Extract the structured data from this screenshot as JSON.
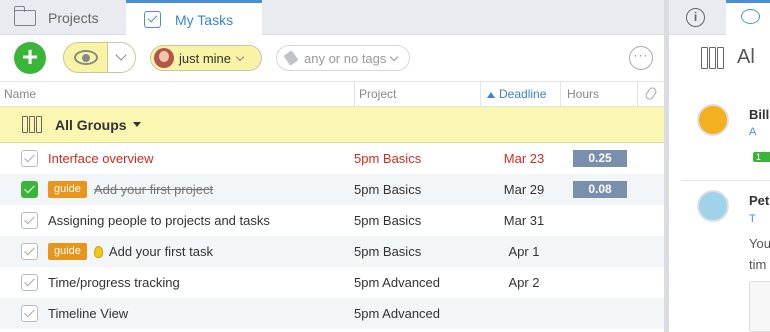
{
  "tabs": {
    "projects": "Projects",
    "my_tasks": "My Tasks"
  },
  "toolbar": {
    "filter_user": "just mine",
    "filter_tags": "any or no tags",
    "more": "···"
  },
  "columns": {
    "name": "Name",
    "project": "Project",
    "deadline": "Deadline",
    "hours": "Hours"
  },
  "group": {
    "label": "All Groups"
  },
  "tasks": [
    {
      "name": "Interface overview",
      "project": "5pm Basics",
      "deadline": "Mar 23",
      "hours": "0.25"
    },
    {
      "tag": "guide",
      "name": "Add your first project",
      "project": "5pm Basics",
      "deadline": "Mar 29",
      "hours": "0.08"
    },
    {
      "name": "Assigning people to projects and tasks",
      "project": "5pm Basics",
      "deadline": "Mar 31"
    },
    {
      "tag": "guide",
      "name": "Add your first task",
      "project": "5pm Basics",
      "deadline": "Apr 1"
    },
    {
      "name": "Time/progress tracking",
      "project": "5pm Advanced",
      "deadline": "Apr 2"
    },
    {
      "name": "Timeline View",
      "project": "5pm Advanced",
      "deadline": ""
    }
  ],
  "right_panel": {
    "title": "Al",
    "people": [
      {
        "name": "Bill",
        "sub": "A",
        "badge": "1"
      },
      {
        "name": "Pet",
        "sub": "T",
        "text1": "You",
        "text2": "tim"
      }
    ]
  },
  "colors": {
    "accent": "#3a84d4",
    "overdue": "#d42a1f",
    "group_bg": "#fbf6b2",
    "add": "#3ab53a",
    "hours_badge": "#7a8fab",
    "guide_tag": "#e8951c"
  }
}
